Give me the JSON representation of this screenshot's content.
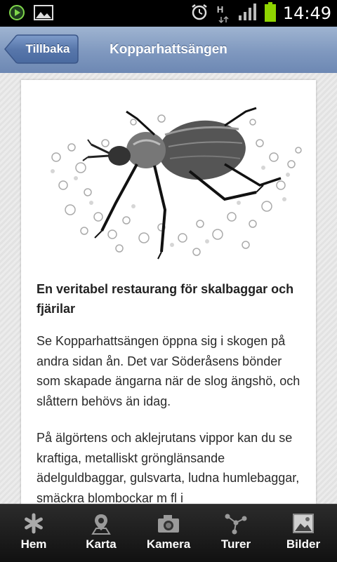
{
  "status_bar": {
    "time": "14:49",
    "network_label": "H",
    "icons": [
      "media-player-icon",
      "gallery-icon",
      "alarm-icon",
      "hspa-data-icon",
      "signal-icon",
      "battery-icon"
    ]
  },
  "header": {
    "back_label": "Tillbaka",
    "title": "Kopparhattsängen"
  },
  "article": {
    "image": "beetle-illustration",
    "heading": "En veritabel restaurang för skalbaggar och fjärilar",
    "paragraphs": [
      "Se Kopparhattsängen öppna sig i skogen på andra sidan ån. Det var Söderåsens bönder som skapade ängarna när de slog ängshö, och slåttern behövs än idag.",
      "På älgörtens och aklejrutans vippor kan du se kraftiga, metalliskt grönglänsande ädelguldbaggar, gulsvarta, ludna humlebaggar, smäckra blombockar m fl i"
    ]
  },
  "tabs": [
    {
      "label": "Hem",
      "icon": "asterisk-icon"
    },
    {
      "label": "Karta",
      "icon": "map-pin-icon"
    },
    {
      "label": "Kamera",
      "icon": "camera-icon"
    },
    {
      "label": "Turer",
      "icon": "route-icon"
    },
    {
      "label": "Bilder",
      "icon": "image-icon"
    }
  ],
  "colors": {
    "header": "#7f98bf",
    "back_button": "#5c7fb5",
    "tabbar": "#1a1a1a",
    "battery": "#8fd400"
  }
}
